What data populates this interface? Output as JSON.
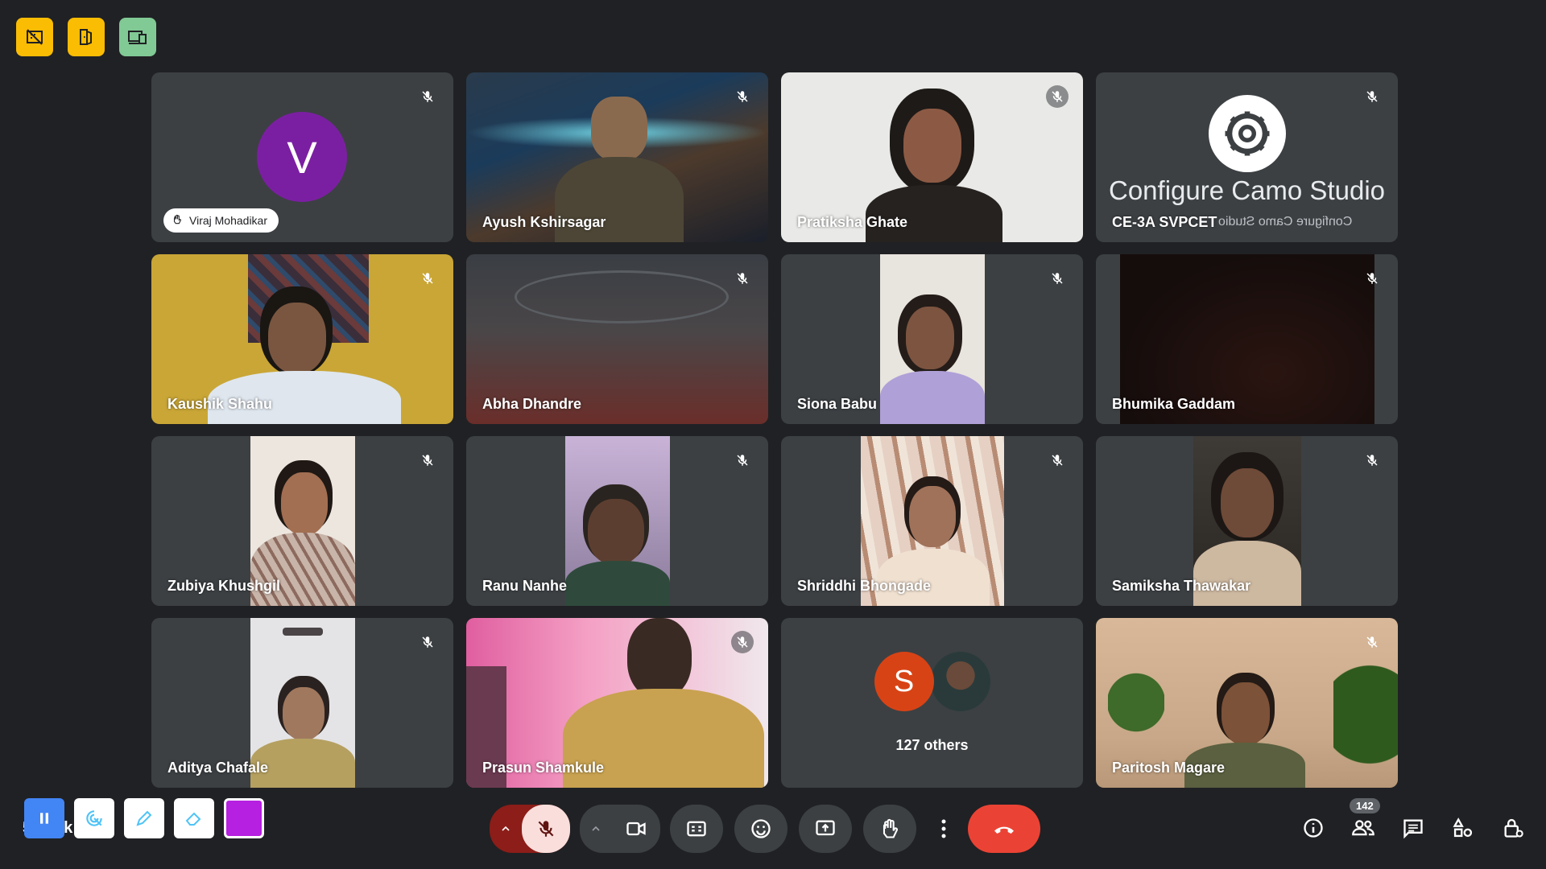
{
  "participants": [
    {
      "name": "Viraj Mohadikar",
      "initial": "V"
    },
    {
      "name": "Ayush Kshirsagar"
    },
    {
      "name": "Pratiksha Ghate"
    },
    {
      "name": "CE-3A SVPCET",
      "overlay_title": "Configure Camo Studio",
      "mirrored_text": "Configure Camo Studio"
    },
    {
      "name": "Kaushik Shahu"
    },
    {
      "name": "Abha Dhandre"
    },
    {
      "name": "Siona Babu"
    },
    {
      "name": "Bhumika Gaddam"
    },
    {
      "name": "Zubiya Khushgil"
    },
    {
      "name": "Ranu Nanhe"
    },
    {
      "name": "Shriddhi Bhongade"
    },
    {
      "name": "Samiksha Thawakar"
    },
    {
      "name": "Aditya Chafale"
    },
    {
      "name": "Prasun Shamkule"
    },
    {
      "others_initial": "S",
      "others_label": "127 others"
    },
    {
      "name": "Paritosh Magare"
    }
  ],
  "bottom_left": {
    "partial_text": "5   M   -   k"
  },
  "people_count": "142",
  "colors": {
    "background": "#202124",
    "tile": "#3c4043",
    "end_call": "#ea4335",
    "accent_yellow": "#fbbc04"
  }
}
